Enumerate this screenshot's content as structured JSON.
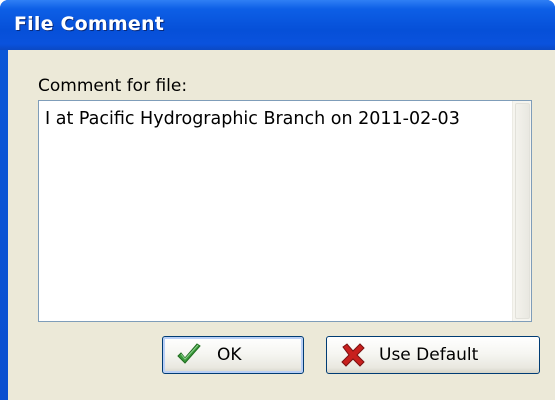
{
  "window": {
    "title": "File Comment"
  },
  "dialog": {
    "comment_label": "Comment for file:",
    "comment_value": "I at Pacific Hydrographic Branch on 2011-02-03"
  },
  "buttons": {
    "ok_label": "OK",
    "ok_icon": "checkmark-icon",
    "default_label": "Use Default",
    "default_icon": "red-x-icon"
  },
  "colors": {
    "titlebar": "#0650d8",
    "client_background": "#ece9d8",
    "button_border": "#003c74",
    "check_green": "#3a9a3a",
    "x_red": "#c8201e"
  }
}
